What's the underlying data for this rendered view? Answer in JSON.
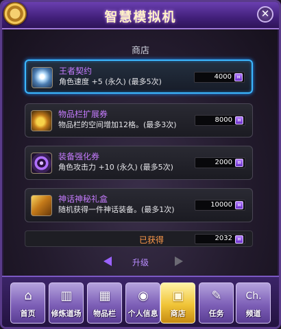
{
  "window": {
    "title": "智慧模拟机",
    "close_label": "✕"
  },
  "section": {
    "label": "商店"
  },
  "shop": {
    "items": [
      {
        "name": "王者契约",
        "desc": "角色速度 +5 (永久) (最多5次)",
        "price": "4000",
        "icon": "sparkle-contract-icon"
      },
      {
        "name": "物品栏扩展券",
        "desc": "物品栏的空间增加12格。(最多3次)",
        "price": "8000",
        "icon": "bag-expansion-icon"
      },
      {
        "name": "装备强化券",
        "desc": "角色攻击力 +10 (永久) (最多5次)",
        "price": "2000",
        "icon": "enhancement-orb-icon"
      },
      {
        "name": "神话神秘礼盒",
        "desc": "随机获得一件神话装备。(最多1次)",
        "price": "10000",
        "icon": "mystery-box-icon"
      }
    ],
    "currency_symbol": "¤"
  },
  "obtained": {
    "label": "已获得",
    "value": "2032"
  },
  "upgrade": {
    "label": "升级"
  },
  "nav": {
    "items": [
      {
        "label": "首页",
        "icon": "home-icon"
      },
      {
        "label": "修炼道场",
        "icon": "training-icon"
      },
      {
        "label": "物品栏",
        "icon": "inventory-icon"
      },
      {
        "label": "个人信息",
        "icon": "profile-icon"
      },
      {
        "label": "商店",
        "icon": "shop-icon"
      },
      {
        "label": "任务",
        "icon": "quest-icon"
      },
      {
        "label": "频道",
        "icon": "channel-icon"
      }
    ],
    "channel_glyph": "Ch."
  },
  "colors": {
    "accent_purple": "#c67cff",
    "selected_border": "#3cb8ff",
    "obtained_label": "#ff9a4a",
    "active_tab": "#f0c437"
  }
}
